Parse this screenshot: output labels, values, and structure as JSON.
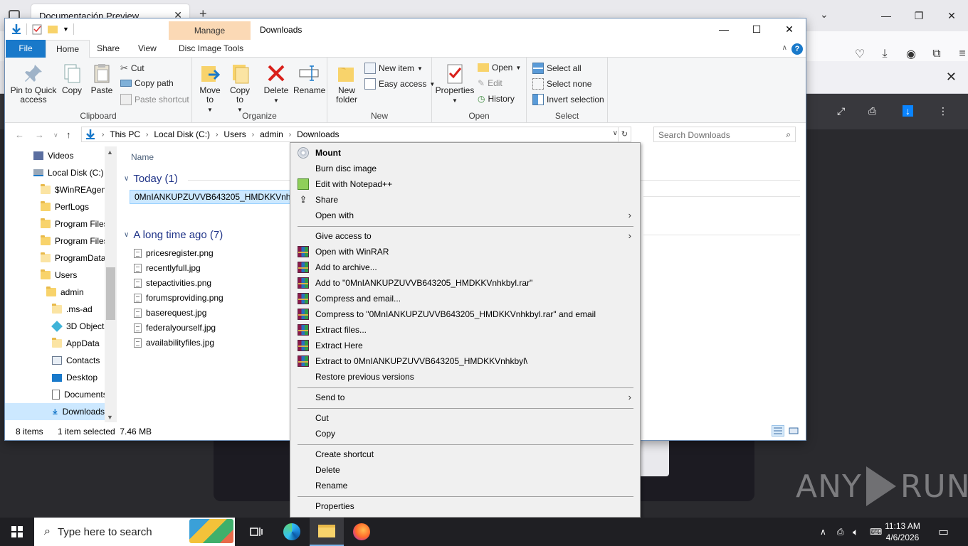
{
  "browser": {
    "tab_title": "Documentación Preview",
    "close_tab": "✕",
    "new_tab": "+",
    "dropdown": "⌄",
    "window_buttons": [
      "—",
      "❐",
      "✕"
    ],
    "notif_close": "✕"
  },
  "explorer": {
    "title": "Downloads",
    "manage_tab": "Manage",
    "window_buttons": [
      "—",
      "☐",
      "✕"
    ],
    "tabs": {
      "file": "File",
      "home": "Home",
      "share": "Share",
      "view": "View",
      "disc_tools": "Disc Image Tools"
    },
    "ribbon": {
      "clipboard": {
        "label": "Clipboard",
        "pin": "Pin to Quick access",
        "copy": "Copy",
        "paste": "Paste",
        "cut": "Cut",
        "copy_path": "Copy path",
        "paste_shortcut": "Paste shortcut"
      },
      "organize": {
        "label": "Organize",
        "move_to": "Move to",
        "copy_to": "Copy to",
        "delete": "Delete",
        "rename": "Rename"
      },
      "new": {
        "label": "New",
        "new_folder": "New folder",
        "new_item": "New item",
        "easy_access": "Easy access"
      },
      "open": {
        "label": "Open",
        "properties": "Properties",
        "open": "Open",
        "edit": "Edit",
        "history": "History"
      },
      "select": {
        "label": "Select",
        "select_all": "Select all",
        "select_none": "Select none",
        "invert": "Invert selection"
      }
    },
    "address": {
      "crumbs": [
        "This PC",
        "Local Disk (C:)",
        "Users",
        "admin",
        "Downloads"
      ],
      "search_placeholder": "Search Downloads"
    },
    "nav_items": [
      {
        "label": "Videos"
      },
      {
        "label": "Local Disk (C:)"
      },
      {
        "label": "$WinREAgent"
      },
      {
        "label": "PerfLogs"
      },
      {
        "label": "Program Files"
      },
      {
        "label": "Program Files"
      },
      {
        "label": "ProgramData"
      },
      {
        "label": "Users"
      },
      {
        "label": "admin"
      },
      {
        "label": ".ms-ad"
      },
      {
        "label": "3D Objects"
      },
      {
        "label": "AppData"
      },
      {
        "label": "Contacts"
      },
      {
        "label": "Desktop"
      },
      {
        "label": "Documents"
      },
      {
        "label": "Downloads"
      }
    ],
    "column_name": "Name",
    "group_today": "Today (1)",
    "group_old": "A long time ago (7)",
    "selected_file": "0MnIANKUPZUVVB643205_HMDKKVnhkbyl.iso",
    "files": [
      "pricesregister.png",
      "recentlyfull.jpg",
      "stepactivities.png",
      "forumsproviding.png",
      "baserequest.jpg",
      "federalyourself.jpg",
      "availabilityfiles.jpg"
    ],
    "status": {
      "items": "8 items",
      "selected": "1 item selected  7.46 MB"
    }
  },
  "context_menu": {
    "mount": "Mount",
    "burn": "Burn disc image",
    "notepad": "Edit with Notepad++",
    "share": "Share",
    "open_with": "Open with",
    "give_access": "Give access to",
    "winrar_open": "Open with WinRAR",
    "add_archive": "Add to archive...",
    "add_to_rar": "Add to \"0MnIANKUPZUVVB643205_HMDKKVnhkbyl.rar\"",
    "compress_email": "Compress and email...",
    "compress_to_email": "Compress to \"0MnIANKUPZUVVB643205_HMDKKVnhkbyl.rar\" and email",
    "extract_files": "Extract files...",
    "extract_here": "Extract Here",
    "extract_to": "Extract to 0MnIANKUPZUVVB643205_HMDKKVnhkbyl\\",
    "restore": "Restore previous versions",
    "send_to": "Send to",
    "cut": "Cut",
    "copy": "Copy",
    "create_shortcut": "Create shortcut",
    "delete": "Delete",
    "rename": "Rename",
    "properties": "Properties",
    "submenu_arrow": "›"
  },
  "taskbar": {
    "search_placeholder": "Type here to search",
    "time": "11:13 AM",
    "date": "4/6/2026"
  },
  "watermark": {
    "left": "ANY",
    "right": "RUN"
  },
  "colors": {
    "accent": "#1979ca",
    "selection": "#cce8ff",
    "manage_tab": "#fbd9b5"
  }
}
